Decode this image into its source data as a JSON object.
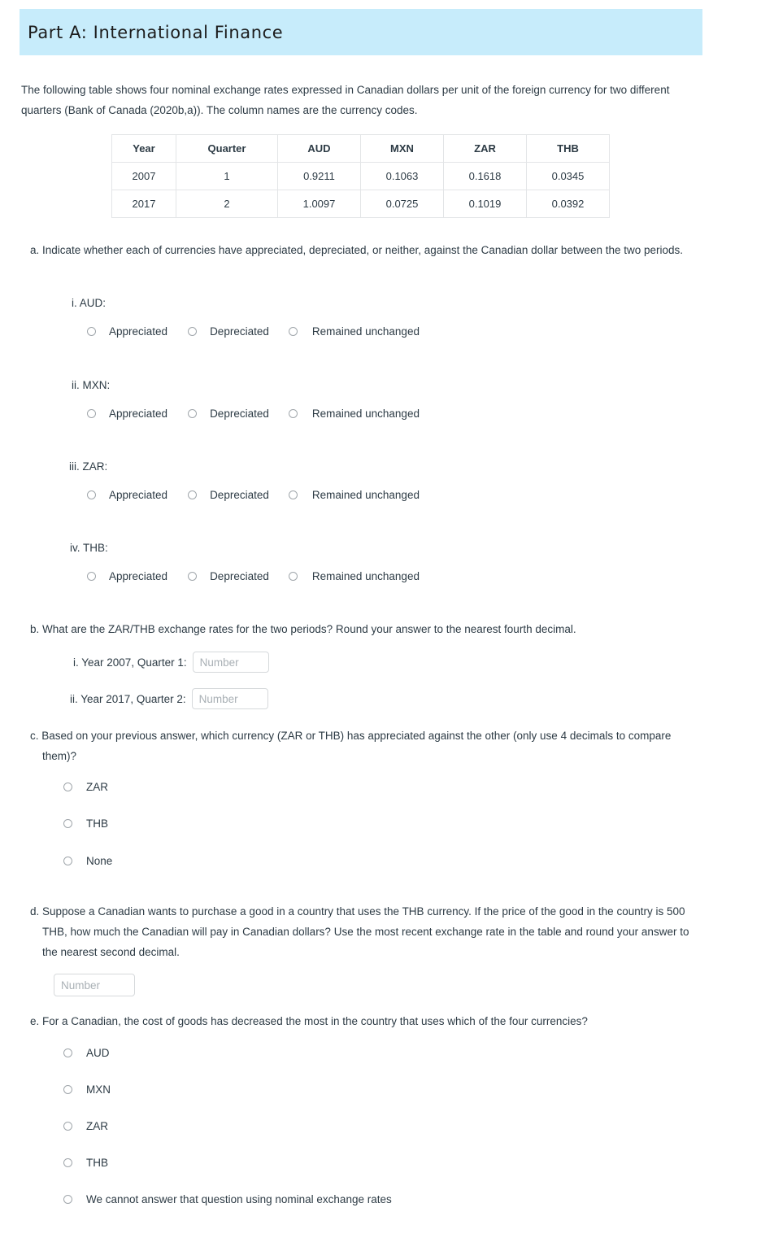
{
  "banner": {
    "title": "Part A: International Finance",
    "background_color": "#c7ecfb"
  },
  "intro": {
    "text": "The following table shows four nominal exchange rates expressed in Canadian dollars per unit of the foreign currency for two different quarters (Bank of Canada (2020b,a)). The column names are the currency codes."
  },
  "table": {
    "headers": [
      "Year",
      "Quarter",
      "AUD",
      "MXN",
      "ZAR",
      "THB"
    ],
    "rows": [
      [
        "2007",
        "1",
        "0.9211",
        "0.1063",
        "0.1618",
        "0.0345"
      ],
      [
        "2017",
        "2",
        "1.0097",
        "0.0725",
        "0.1019",
        "0.0392"
      ]
    ]
  },
  "questions": {
    "a": {
      "text": "a. Indicate whether each of currencies have appreciated, depreciated, or neither, against the Canadian dollar between the two periods.",
      "options": [
        "Appreciated",
        "Depreciated",
        "Remained unchanged"
      ],
      "items": [
        {
          "label": "i. AUD:"
        },
        {
          "label": "ii. MXN:"
        },
        {
          "label": "iii. ZAR:"
        },
        {
          "label": "iv. THB:"
        }
      ]
    },
    "b": {
      "text": "b. What are the ZAR/THB exchange rates for the two periods? Round your answer to the nearest fourth decimal.",
      "fields": [
        {
          "label": "i. Year 2007, Quarter 1:",
          "value": "",
          "placeholder": "Number"
        },
        {
          "label": "ii. Year 2017, Quarter 2:",
          "value": "",
          "placeholder": "Number"
        }
      ]
    },
    "c": {
      "text": "c. Based on your previous answer, which currency (ZAR or THB) has appreciated against the other (only use 4 decimals to compare them)?",
      "options": [
        "ZAR",
        "THB",
        "None"
      ]
    },
    "d": {
      "text": "d. Suppose a Canadian wants to purchase a good in a country that uses the THB currency. If the price of the good in the country is 500 THB, how much the Canadian will pay in Canadian dollars? Use the most recent exchange rate in the table and round your answer to the nearest second decimal.",
      "field": {
        "value": "",
        "placeholder": "Number"
      }
    },
    "e": {
      "text": "e. For a Canadian, the cost of goods has decreased the most in the country that uses which of the four currencies?",
      "options": [
        "AUD",
        "MXN",
        "ZAR",
        "THB",
        "We cannot answer that question using nominal exchange rates"
      ]
    }
  }
}
